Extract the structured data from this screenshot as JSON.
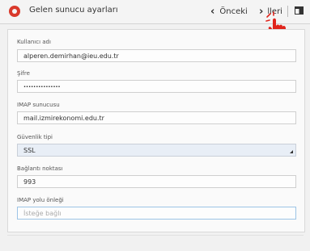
{
  "action_bar": {
    "title": "Gelen sunucu ayarları",
    "prev_label": "Önceki",
    "next_label": "lleri",
    "prev_icon": "chevron-left-icon",
    "next_icon": "chevron-right-icon",
    "app_icon": "email-app-icon",
    "window_icon": "window-icon"
  },
  "form": {
    "username": {
      "label": "Kullanıcı adı",
      "value": "alperen.demirhan@ieu.edu.tr"
    },
    "password": {
      "label": "Şifre",
      "value": "···············"
    },
    "imap_server": {
      "label": "IMAP sunucusu",
      "value": "mail.izmirekonomi.edu.tr"
    },
    "security": {
      "label": "Güvenlik tipi",
      "value": "SSL"
    },
    "port": {
      "label": "Bağlantı noktası",
      "value": "993"
    },
    "imap_prefix": {
      "label": "IMAP yolu önleği",
      "placeholder": "İsteğe bağlı"
    }
  },
  "colors": {
    "accent": "#d9392b",
    "select_bg": "#e8eef6",
    "focus_border": "#9dc4e6",
    "hand": "#e0241c"
  }
}
